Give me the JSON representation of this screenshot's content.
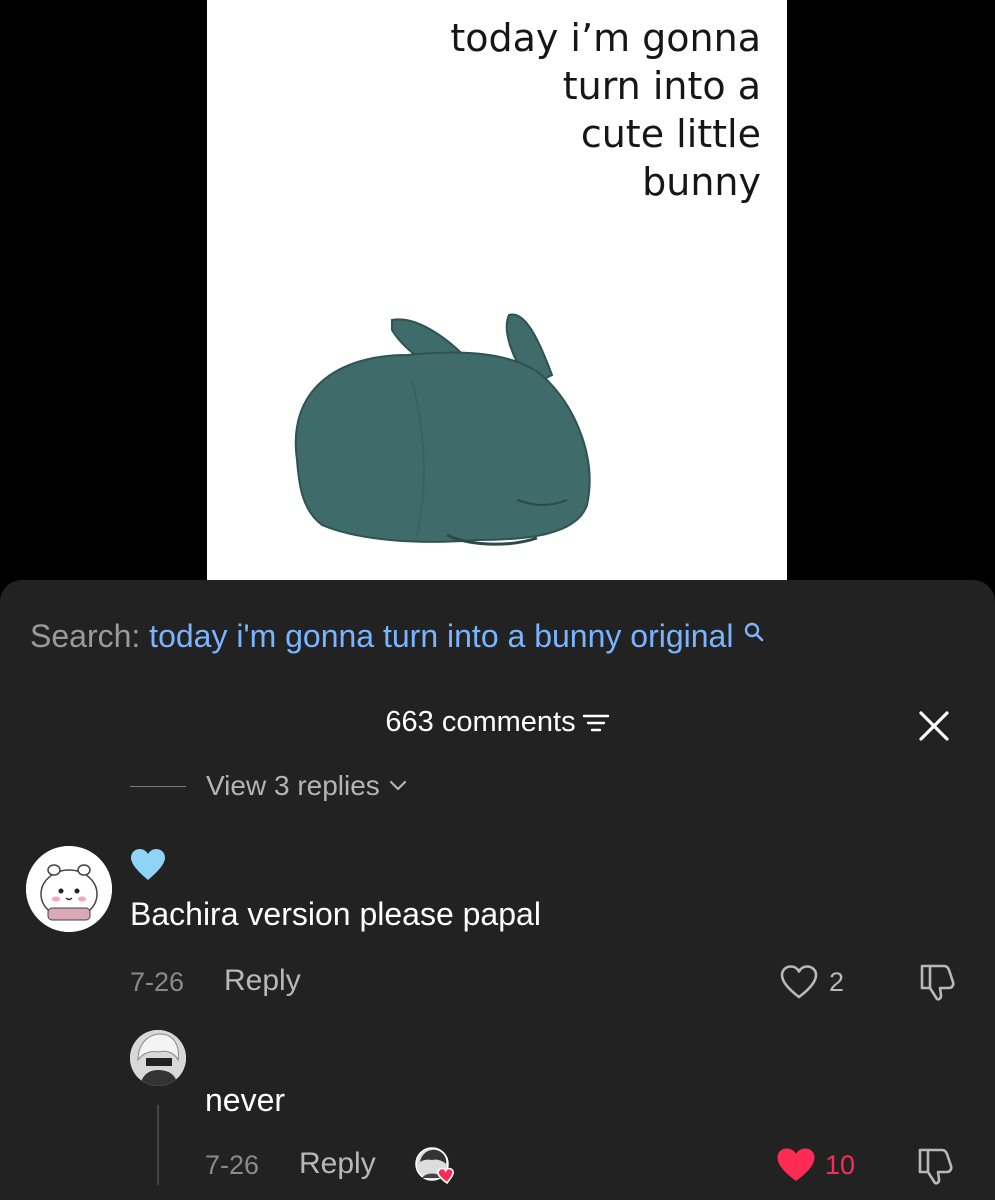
{
  "meme": {
    "caption": "today i’m gonna\nturn into a\ncute little\nbunny"
  },
  "search": {
    "label": "Search:",
    "query": "today i'm gonna turn into a bunny original"
  },
  "comments_header": {
    "count_label": "663 comments"
  },
  "view_replies": {
    "label": "View 3 replies"
  },
  "comment": {
    "emoji": "blue-heart",
    "text": "Bachira version please papal",
    "date": "7-26",
    "reply_label": "Reply",
    "like_count": "2"
  },
  "reply": {
    "text": "never",
    "date": "7-26",
    "reply_label": "Reply",
    "like_count": "10",
    "liked": true
  },
  "colors": {
    "panel_bg": "#222222",
    "search_link": "#7ab4ff",
    "like_red": "#fe2c55",
    "bunny": "#3f6b6a"
  }
}
